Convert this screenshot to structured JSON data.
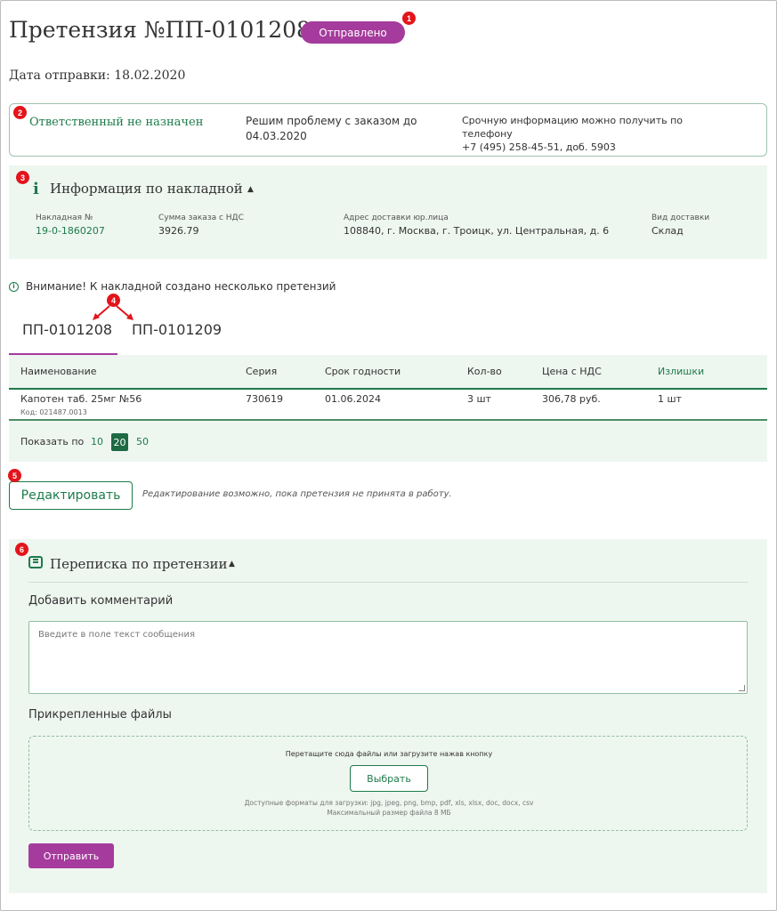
{
  "header": {
    "title": "Претензия №ПП-0101208",
    "status": "Отправлено",
    "sent_date": "Дата отправки: 18.02.2020"
  },
  "markers": [
    "1",
    "2",
    "3",
    "4",
    "5",
    "6"
  ],
  "responsible": {
    "status": "Ответственный не назначен",
    "resolve_line1": "Решим проблему с заказом до",
    "resolve_line2": "04.03.2020",
    "phone_line1": "Срочную информацию можно получить по телефону",
    "phone_line2": "+7 (495) 258-45-51, доб. 5903"
  },
  "invoice": {
    "icon": "info-icon",
    "title": "Информация по накладной",
    "fields": [
      {
        "label": "Накладная №",
        "value": "19-0-1860207"
      },
      {
        "label": "Сумма заказа с НДС",
        "value": "3926.79"
      },
      {
        "label": "Адрес доставки юр.лица",
        "value": "108840, г. Москва, г. Троицк, ул. Центральная, д. 6"
      },
      {
        "label": "Вид доставки",
        "value": "Склад"
      }
    ]
  },
  "warning": "Внимание! К накладной создано несколько претензий",
  "tabs": [
    {
      "label": "ПП-0101208",
      "active": true
    },
    {
      "label": "ПП-0101209",
      "active": false
    }
  ],
  "table": {
    "headers": [
      "Наименование",
      "Серия",
      "Срок годности",
      "Кол-во",
      "Цена с НДС",
      "Излишки"
    ],
    "rows": [
      {
        "name": "Капотен таб. 25мг №56",
        "code": "Код: 021487.0013",
        "series": "730619",
        "expiry": "01.06.2024",
        "qty": "3 шт",
        "price": "306,78 руб.",
        "surplus": "1 шт"
      }
    ],
    "pagination": {
      "label": "Показать по",
      "options": [
        "10",
        "20",
        "50"
      ],
      "selected": "20"
    }
  },
  "edit": {
    "button": "Редактировать",
    "note": "Редактирование возможно, пока претензия не принята в работу."
  },
  "correspondence": {
    "icon": "chat-icon",
    "title": "Переписка по претензии",
    "comment_heading": "Добавить комментарий",
    "comment_placeholder": "Введите в поле текст сообщения",
    "files_heading": "Прикрепленные файлы",
    "drop_text": "Перетащите сюда файлы или загрузите нажав кнопку",
    "choose_button": "Выбрать",
    "formats": "Доступные форматы для загрузки: jpg, jpeg, png, bmp, pdf, xls, xlsx, doc, docx, csv",
    "max_size": "Максимальный размер файла 8 МБ",
    "send_button": "Отправить"
  },
  "colors": {
    "accent_purple": "#a53b9c",
    "accent_green": "#1d7b4a",
    "panel_bg": "#eef6f0",
    "marker_red": "#e3141b"
  }
}
